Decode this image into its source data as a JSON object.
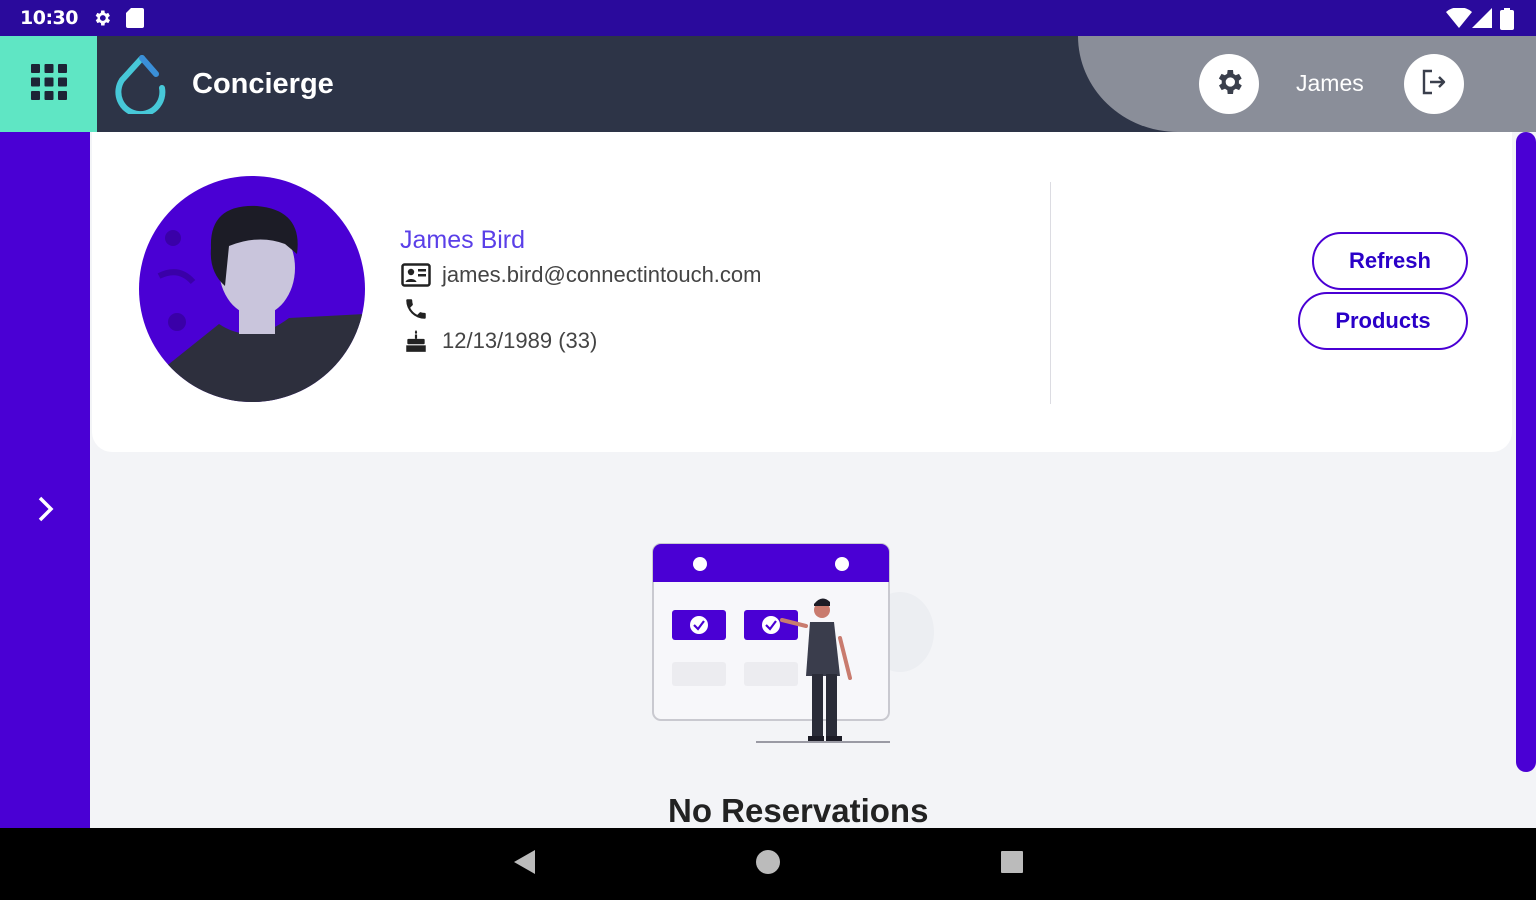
{
  "status_bar": {
    "time": "10:30"
  },
  "app_bar": {
    "title": "Concierge",
    "user_name": "James"
  },
  "profile": {
    "name": "James Bird",
    "email": "james.bird@connectintouch.com",
    "phone": "",
    "birthdate": "12/13/1989 (33)"
  },
  "actions": {
    "refresh_label": "Refresh",
    "products_label": "Products"
  },
  "reservations": {
    "empty_title": "No Reservations"
  },
  "colors": {
    "status_bar": "#2a0a9c",
    "app_bar": "#2d3447",
    "accent_teal": "#5fe6c4",
    "primary": "#4a00d4",
    "background": "#f3f4f7"
  },
  "icons": {
    "grid": "apps-grid-icon",
    "settings": "gear-icon",
    "logout": "logout-icon",
    "expand": "chevron-right-icon",
    "email": "contact-card-icon",
    "phone": "phone-icon",
    "birthdate": "cake-icon"
  }
}
